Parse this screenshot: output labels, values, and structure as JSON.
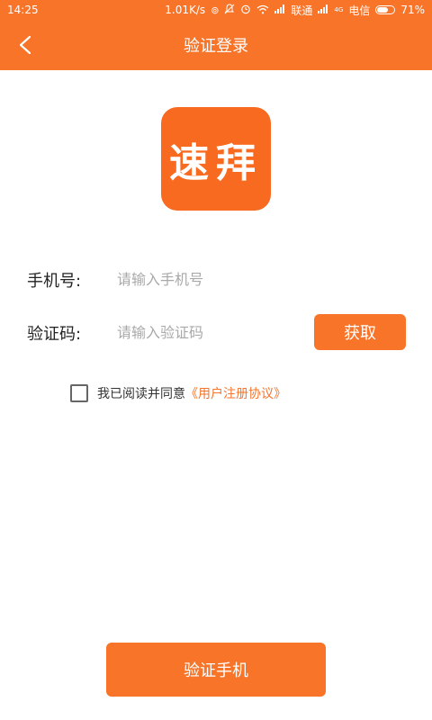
{
  "status_bar": {
    "time": "14:25",
    "speed": "1.01K/s",
    "carrier1": "联通",
    "carrier2": "电信",
    "network_badge": "4G",
    "battery": "71%",
    "battery_level": 0.71
  },
  "app_bar": {
    "title": "验证登录",
    "back_icon": "chevron-left-icon"
  },
  "logo": {
    "text": "速拜",
    "color": "#f76a1f"
  },
  "form": {
    "phone_label": "手机号:",
    "phone_placeholder": "请输入手机号",
    "phone_value": "",
    "code_label": "验证码:",
    "code_placeholder": "请输入验证码",
    "code_value": "",
    "get_code_label": "获取"
  },
  "agreement": {
    "checked": false,
    "text": "我已阅读并同意",
    "link": "《用户注册协议》"
  },
  "submit": {
    "label": "验证手机"
  },
  "colors": {
    "accent": "#f77428"
  }
}
